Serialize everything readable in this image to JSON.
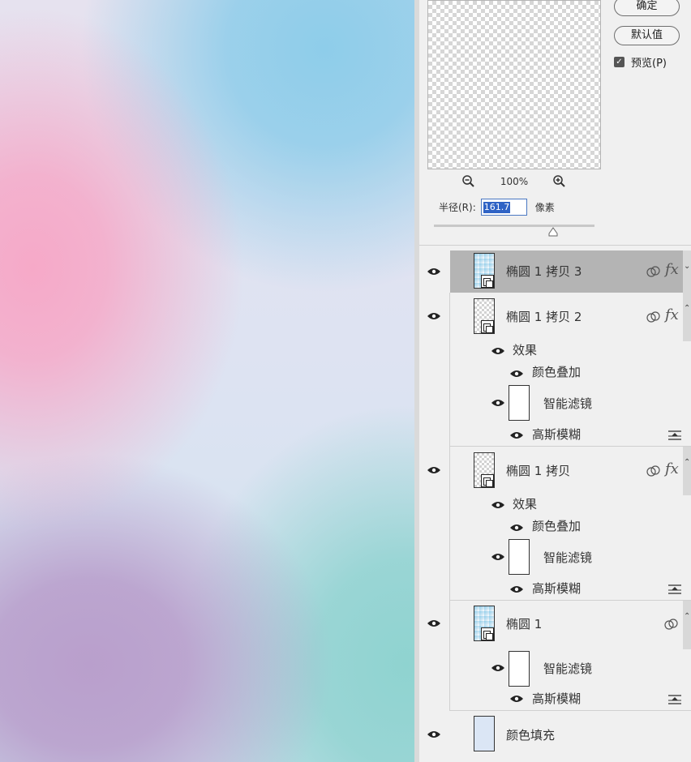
{
  "dialog": {
    "ok_label": "确定",
    "default_label": "默认值",
    "preview_label": "预览(P)",
    "preview_checked": true,
    "zoom_label": "100%",
    "radius_label": "半径(R):",
    "radius_value": "161.7",
    "radius_unit": "像素"
  },
  "layers": [
    {
      "name": "椭圆 1 拷贝 3",
      "selected": true,
      "fx": "fx",
      "collapsed": true
    },
    {
      "name": "椭圆 1 拷贝 2",
      "fx": "fx",
      "effects_label": "效果",
      "effect": "颜色叠加",
      "smart_filter_label": "智能滤镜",
      "filter": "高斯模糊"
    },
    {
      "name": "椭圆 1 拷贝",
      "fx": "fx",
      "effects_label": "效果",
      "effect": "颜色叠加",
      "smart_filter_label": "智能滤镜",
      "filter": "高斯模糊"
    },
    {
      "name": "椭圆 1",
      "smart_filter_label": "智能滤镜",
      "filter": "高斯模糊"
    },
    {
      "name": "颜色填充",
      "fill_color": "#dbe6f5"
    }
  ],
  "colors": {
    "selected_row": "#b4b4b4",
    "accent_blue": "#2f63c5"
  }
}
